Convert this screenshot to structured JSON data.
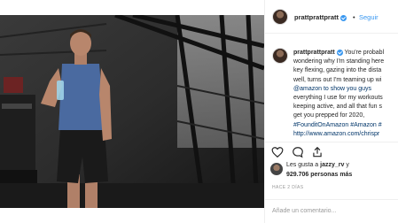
{
  "header": {
    "username": "prattprattpratt",
    "separator": "•",
    "follow_label": "Seguir"
  },
  "caption": {
    "username": "prattprattpratt",
    "lines": [
      "You're probabl",
      "wondering why I'm standing here",
      "key flexing, gazing into the dista",
      "well, turns out I'm teaming up wi",
      "@amazon to show you guys",
      "everything I use for my workouts",
      "keeping active, and all that fun s",
      "get you prepped for 2020,",
      "#FounditOnAmazon #Amazon #",
      "http://www.amazon.com/chrispr"
    ]
  },
  "likes": {
    "prefix": "Les gusta a",
    "user": "jazzy_rv",
    "conj": "y",
    "count": "929.706 personas más"
  },
  "timestamp": "HACE 2 DÍAS",
  "comment_placeholder": "Añade un comentario..."
}
